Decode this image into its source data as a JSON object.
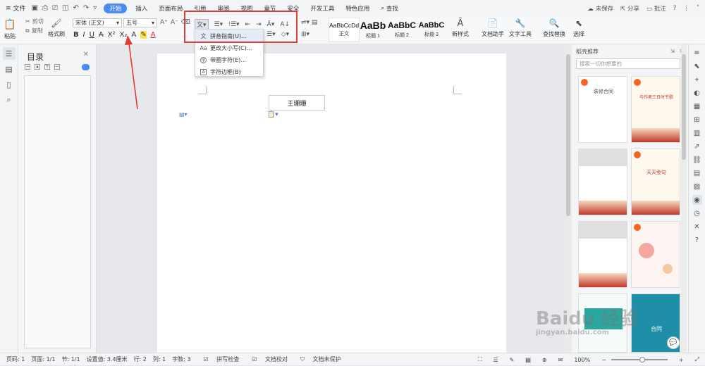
{
  "menubar": {
    "file_label": "文件",
    "tabs": [
      {
        "label": "开始",
        "active": true
      },
      {
        "label": "插入"
      },
      {
        "label": "页面布局"
      },
      {
        "label": "引用"
      },
      {
        "label": "审阅"
      },
      {
        "label": "视图"
      },
      {
        "label": "章节"
      },
      {
        "label": "安全"
      },
      {
        "label": "开发工具"
      },
      {
        "label": "特色应用"
      }
    ],
    "search_label": "查找",
    "unsaved_label": "未保存",
    "share_label": "分享",
    "comment_label": "批注"
  },
  "ribbon": {
    "paste_label": "粘贴",
    "cut_label": "剪切",
    "copy_label": "复制",
    "format_painter_label": "格式刷",
    "font_name": "宋体 (正文)",
    "font_size": "五号",
    "styles": [
      {
        "preview": "AaBbCcDd",
        "label": "正文"
      },
      {
        "preview": "AaBb",
        "label": "标题 1"
      },
      {
        "preview": "AaBbC",
        "label": "标题 2"
      },
      {
        "preview": "AaBbC",
        "label": "标题 3"
      }
    ],
    "new_style_label": "新样式",
    "doc_assistant_label": "文档助手",
    "text_tools_label": "文字工具",
    "find_replace_label": "查找替换",
    "select_label": "选择"
  },
  "dropdown": {
    "items": [
      {
        "label": "拼音指南(U)...",
        "icon": "pinyin-icon",
        "highlighted": true
      },
      {
        "label": "更改大小写(C)...",
        "icon": "case-icon"
      },
      {
        "label": "带圈字符(E)...",
        "icon": "circle-char-icon"
      },
      {
        "label": "字符边框(B)",
        "icon": "char-border-icon"
      }
    ]
  },
  "toc": {
    "title": "目录"
  },
  "document": {
    "name_text": "王珊珊"
  },
  "right_panel": {
    "title": "稻壳推荐",
    "search_placeholder": "搜索一切你想要的",
    "cards": [
      {
        "title": "装修合同"
      },
      {
        "title": "与作者三日时节歌"
      },
      {
        "title": ""
      },
      {
        "title": "天天金句"
      },
      {
        "title": ""
      },
      {
        "title": ""
      },
      {
        "title": ""
      },
      {
        "title": "合同"
      }
    ]
  },
  "status": {
    "page_no": "页码: 1",
    "page_count": "页面: 1/1",
    "section": "节: 1/1",
    "setting": "设置值: 3.4厘米",
    "row": "行: 2",
    "col": "列: 1",
    "words": "字数: 3",
    "spell": "拼写检查",
    "proof": "文档校对",
    "protect": "文档未保护",
    "zoom": "100%"
  },
  "watermark": "Baidu 经验",
  "watermark_url": "jingyan.baidu.com",
  "colors": {
    "accent": "#4c8bf5",
    "highlight_box": "#e53935",
    "arrow": "#e53935"
  }
}
